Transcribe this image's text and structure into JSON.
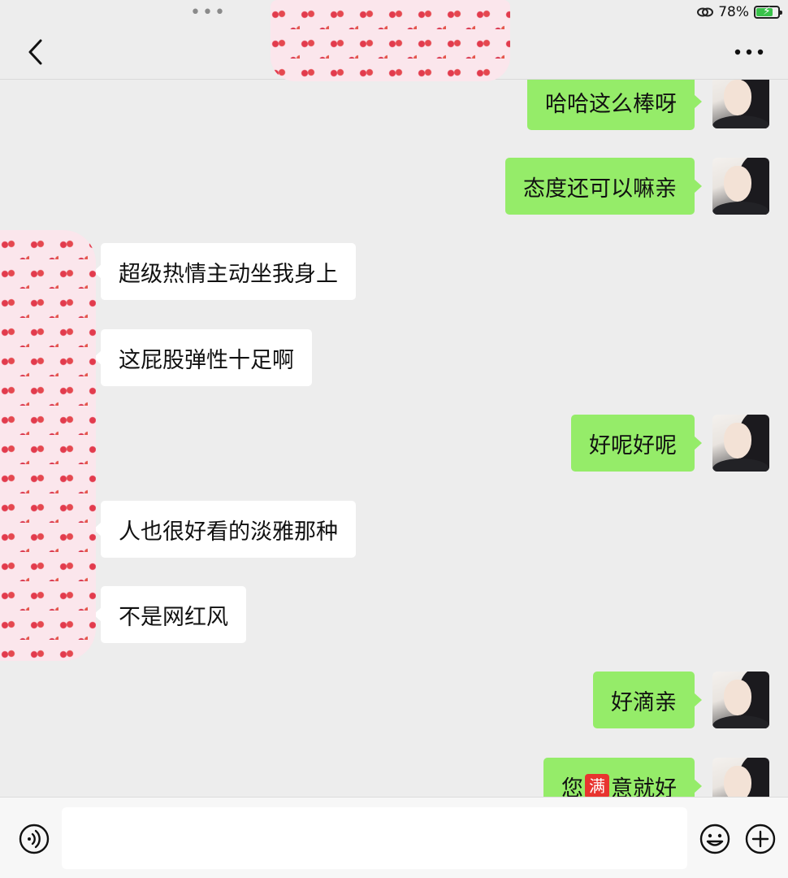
{
  "status_bar": {
    "battery_text": "78%",
    "battery_level": 0.78,
    "icons": [
      "multi-window-dots-icon",
      "link-icon",
      "battery-charging-icon"
    ]
  },
  "nav": {
    "icons": [
      "back-chevron-icon",
      "more-dots-icon"
    ]
  },
  "colors": {
    "background": "#ededed",
    "sent_bubble": "#95ec69",
    "received_bubble": "#ffffff",
    "badge_red": "#e8342f"
  },
  "messages": [
    {
      "side": "right",
      "text": "哈哈这么棒呀"
    },
    {
      "side": "right",
      "text": "态度还可以嘛亲"
    },
    {
      "side": "left",
      "text": "超级热情主动坐我身上"
    },
    {
      "side": "left",
      "text": "这屁股弹性十足啊"
    },
    {
      "side": "right",
      "text": "好呢好呢"
    },
    {
      "side": "left",
      "text": "人也很好看的淡雅那种"
    },
    {
      "side": "left",
      "text": "不是网红风"
    },
    {
      "side": "right",
      "text": "好滴亲"
    },
    {
      "side": "right",
      "text_before": "您",
      "badge": "满",
      "text_after": "意就好"
    }
  ],
  "input_bar": {
    "placeholder": "",
    "icons": [
      "voice-icon",
      "emoji-icon",
      "plus-icon"
    ]
  }
}
